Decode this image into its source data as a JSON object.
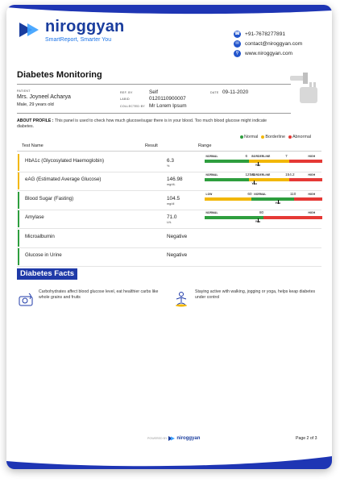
{
  "brand": {
    "name": "niroggyan",
    "tagline": "SmartReport, Smarter You",
    "footer_name": "niroggyan",
    "powered_by": "POWERED BY"
  },
  "contact": {
    "phone": "+91-7678277891",
    "email": "contact@niroggyan.com",
    "website": "www.niroggyan.com"
  },
  "report": {
    "title": "Diabetes Monitoring"
  },
  "patient": {
    "patient_label": "PATIENT",
    "name": "Mrs. Joyneel Acharya",
    "details": "Male, 29 years old",
    "ref_label": "REF. BY",
    "ref_by": "Self",
    "labid_label": "LABID",
    "lab_id": "0120110900007",
    "collected_label": "COLLECTED BY",
    "collected_by": "Mr Lorem Ipsum",
    "date_label": "DATE",
    "date": "09-11-2020"
  },
  "about": {
    "label": "ABOUT PROFILE :",
    "text": " This panel is used to check how much glucose/sugar there is in your blood. Too much blood glucose might indicate diabetes."
  },
  "legend": {
    "normal": "Normal",
    "borderline": "Borderline",
    "abnormal": "Abnormal"
  },
  "colors": {
    "normal": "#2e9e3e",
    "borderline": "#f2b705",
    "abnormal": "#e53935",
    "brand": "#1f3aa8"
  },
  "table": {
    "headers": {
      "name": "Test Name",
      "result": "Result",
      "range": "Range"
    },
    "you_label": "You",
    "rows": [
      {
        "name": "HbA1c (Glycosylated Haemoglobin)",
        "value": "6.3",
        "unit": "%",
        "status": "borderline",
        "labels": [
          "NORMAL",
          "BORDERLINE",
          "HIGH"
        ],
        "cut1": "6",
        "cut2": "7",
        "marker": 0.45
      },
      {
        "name": "eAG (Estimated Average Glucose)",
        "value": "146.98",
        "unit": "mg/dL",
        "status": "borderline",
        "labels": [
          "NORMAL",
          "BORDERLINE",
          "HIGH"
        ],
        "cut1": "125.5",
        "cut2": "154.2",
        "marker": 0.42
      },
      {
        "name": "Blood Sugar (Fasting)",
        "value": "104.5",
        "unit": "mg/dl",
        "status": "normal",
        "labels": [
          "LOW",
          "NORMAL",
          "HIGH"
        ],
        "cut1": "60",
        "cut2": "110",
        "marker": 0.62
      },
      {
        "name": "Amylase",
        "value": "71.0",
        "unit": "U/L",
        "status": "normal",
        "labels": [
          "NORMAL",
          "",
          "HIGH"
        ],
        "cut1": "",
        "cut2": "80",
        "marker": 0.45
      },
      {
        "name": "Microalbumin",
        "value": "Negative",
        "unit": "",
        "status": "normal"
      },
      {
        "name": "Glucose in Urine",
        "value": "Negative",
        "unit": "",
        "status": "normal"
      }
    ]
  },
  "facts": {
    "title": "Diabetes Facts",
    "items": [
      {
        "text": "Carbohydrates affect blood glucose level, eat healthier carbs like whole grains and fruits",
        "icon": "food-icon"
      },
      {
        "text": "Staying active with walking, jogging or yoga, helps keap diabetes under control",
        "icon": "yoga-icon"
      }
    ]
  },
  "footer": {
    "page": "Page 2 of 3"
  }
}
